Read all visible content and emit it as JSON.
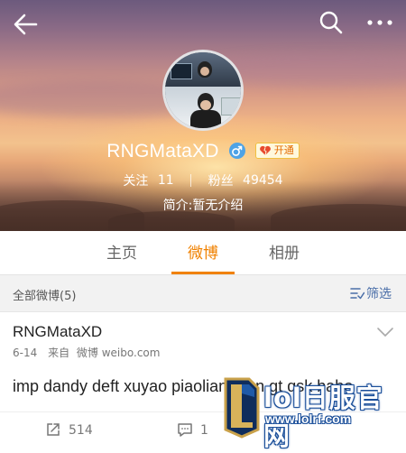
{
  "header": {
    "username": "RNGMataXD",
    "vip_label": "开通",
    "follow_label": "关注",
    "follow_count": "11",
    "fans_label": "粉丝",
    "fans_count": "49454",
    "bio": "简介:暂无介绍"
  },
  "tabs": [
    {
      "label": "主页",
      "active": false
    },
    {
      "label": "微博",
      "active": true
    },
    {
      "label": "相册",
      "active": false
    }
  ],
  "filter": {
    "title": "全部微博(5)",
    "button_label": "筛选"
  },
  "post": {
    "author": "RNGMataXD",
    "date": "6-14",
    "source_prefix": "来自",
    "source": "微博 weibo.com",
    "text": "imp dandy deft xuyao piaoliang ren gt qsk babo",
    "repost_count": "514",
    "comment_count": "1"
  },
  "watermark": {
    "line1": "lol日服官网",
    "line2": "www.lolrf.com"
  },
  "colors": {
    "accent": "#f08100",
    "link": "#4a6ea8",
    "gender": "#4ea3e6"
  },
  "icons": {
    "back": "arrow-left-icon",
    "search": "search-icon",
    "more": "more-dots-icon",
    "gender": "male-icon",
    "vip": "broken-heart-icon",
    "filter": "filter-icon",
    "menu": "chevron-down-icon",
    "repost": "repost-icon",
    "comment": "comment-icon"
  }
}
